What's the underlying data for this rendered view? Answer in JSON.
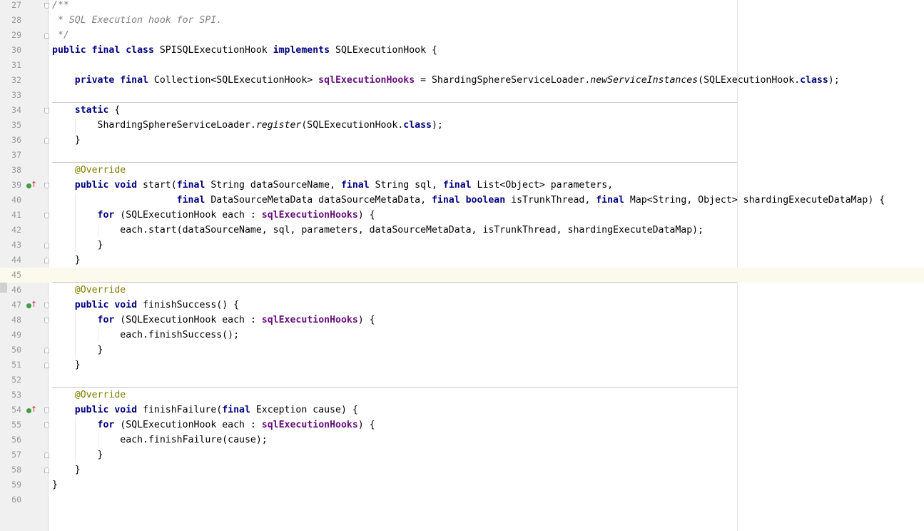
{
  "editor": {
    "lines": [
      {
        "n": "27",
        "tokens": [
          {
            "t": "/**",
            "c": "cm"
          }
        ]
      },
      {
        "n": "28",
        "tokens": [
          {
            "t": " * SQL Execution hook for SPI.",
            "c": "cm"
          }
        ]
      },
      {
        "n": "29",
        "tokens": [
          {
            "t": " */",
            "c": "cm"
          }
        ]
      },
      {
        "n": "30",
        "tokens": [
          {
            "t": "public final class",
            "c": "kw"
          },
          {
            "t": " SPISQLExecutionHook "
          },
          {
            "t": "implements",
            "c": "kw"
          },
          {
            "t": " SQLExecutionHook {"
          }
        ]
      },
      {
        "n": "31",
        "tokens": []
      },
      {
        "n": "32",
        "tokens": [
          {
            "t": "    "
          },
          {
            "t": "private final",
            "c": "kw"
          },
          {
            "t": " Collection<SQLExecutionHook> "
          },
          {
            "t": "sqlExecutionHooks",
            "c": "fd"
          },
          {
            "t": " = ShardingSphereServiceLoader."
          },
          {
            "t": "newServiceInstances",
            "c": "st"
          },
          {
            "t": "(SQLExecutionHook."
          },
          {
            "t": "class",
            "c": "kw"
          },
          {
            "t": ");"
          }
        ]
      },
      {
        "n": "33",
        "tokens": []
      },
      {
        "n": "34",
        "tokens": [
          {
            "t": "    "
          },
          {
            "t": "static",
            "c": "kw"
          },
          {
            "t": " {"
          }
        ]
      },
      {
        "n": "35",
        "tokens": [
          {
            "t": "        ShardingSphereServiceLoader."
          },
          {
            "t": "register",
            "c": "st"
          },
          {
            "t": "(SQLExecutionHook."
          },
          {
            "t": "class",
            "c": "kw"
          },
          {
            "t": ");"
          }
        ]
      },
      {
        "n": "36",
        "tokens": [
          {
            "t": "    }"
          }
        ]
      },
      {
        "n": "37",
        "tokens": []
      },
      {
        "n": "38",
        "tokens": [
          {
            "t": "    "
          },
          {
            "t": "@Override",
            "c": "an"
          }
        ]
      },
      {
        "n": "39",
        "tokens": [
          {
            "t": "    "
          },
          {
            "t": "public void",
            "c": "kw"
          },
          {
            "t": " start("
          },
          {
            "t": "final",
            "c": "kw"
          },
          {
            "t": " String dataSourceName, "
          },
          {
            "t": "final",
            "c": "kw"
          },
          {
            "t": " String sql, "
          },
          {
            "t": "final",
            "c": "kw"
          },
          {
            "t": " List<Object> parameters,"
          }
        ]
      },
      {
        "n": "40",
        "tokens": [
          {
            "t": "                      "
          },
          {
            "t": "final",
            "c": "kw"
          },
          {
            "t": " DataSourceMetaData dataSourceMetaData, "
          },
          {
            "t": "final boolean",
            "c": "kw"
          },
          {
            "t": " isTrunkThread, "
          },
          {
            "t": "final",
            "c": "kw"
          },
          {
            "t": " Map<String, Object> shardingExecuteDataMap) {"
          }
        ]
      },
      {
        "n": "41",
        "tokens": [
          {
            "t": "        "
          },
          {
            "t": "for",
            "c": "kw"
          },
          {
            "t": " (SQLExecutionHook each : "
          },
          {
            "t": "sqlExecutionHooks",
            "c": "fd"
          },
          {
            "t": ") {"
          }
        ]
      },
      {
        "n": "42",
        "tokens": [
          {
            "t": "            each.start(dataSourceName, sql, parameters, dataSourceMetaData, isTrunkThread, shardingExecuteDataMap);"
          }
        ]
      },
      {
        "n": "43",
        "tokens": [
          {
            "t": "        }"
          }
        ]
      },
      {
        "n": "44",
        "tokens": [
          {
            "t": "    }"
          }
        ]
      },
      {
        "n": "45",
        "tokens": []
      },
      {
        "n": "46",
        "tokens": [
          {
            "t": "    "
          },
          {
            "t": "@Override",
            "c": "an"
          }
        ]
      },
      {
        "n": "47",
        "tokens": [
          {
            "t": "    "
          },
          {
            "t": "public void",
            "c": "kw"
          },
          {
            "t": " finishSuccess() {"
          }
        ]
      },
      {
        "n": "48",
        "tokens": [
          {
            "t": "        "
          },
          {
            "t": "for",
            "c": "kw"
          },
          {
            "t": " (SQLExecutionHook each : "
          },
          {
            "t": "sqlExecutionHooks",
            "c": "fd"
          },
          {
            "t": ") {"
          }
        ]
      },
      {
        "n": "49",
        "tokens": [
          {
            "t": "            each.finishSuccess();"
          }
        ]
      },
      {
        "n": "50",
        "tokens": [
          {
            "t": "        }"
          }
        ]
      },
      {
        "n": "51",
        "tokens": [
          {
            "t": "    }"
          }
        ]
      },
      {
        "n": "52",
        "tokens": []
      },
      {
        "n": "53",
        "tokens": [
          {
            "t": "    "
          },
          {
            "t": "@Override",
            "c": "an"
          }
        ]
      },
      {
        "n": "54",
        "tokens": [
          {
            "t": "    "
          },
          {
            "t": "public void",
            "c": "kw"
          },
          {
            "t": " finishFailure("
          },
          {
            "t": "final",
            "c": "kw"
          },
          {
            "t": " Exception cause) {"
          }
        ]
      },
      {
        "n": "55",
        "tokens": [
          {
            "t": "        "
          },
          {
            "t": "for",
            "c": "kw"
          },
          {
            "t": " (SQLExecutionHook each : "
          },
          {
            "t": "sqlExecutionHooks",
            "c": "fd"
          },
          {
            "t": ") {"
          }
        ]
      },
      {
        "n": "56",
        "tokens": [
          {
            "t": "            each.finishFailure(cause);"
          }
        ]
      },
      {
        "n": "57",
        "tokens": [
          {
            "t": "        }"
          }
        ]
      },
      {
        "n": "58",
        "tokens": [
          {
            "t": "    }"
          }
        ]
      },
      {
        "n": "59",
        "tokens": [
          {
            "t": "}"
          }
        ]
      },
      {
        "n": "60",
        "tokens": []
      }
    ],
    "current_line": "45",
    "method_separators_after": [
      "33",
      "37",
      "45",
      "52"
    ],
    "override_markers": [
      "39",
      "47",
      "54"
    ],
    "override_marker_icon": "override-method-icon",
    "fold_start_lines": [
      "27",
      "34",
      "39",
      "41",
      "47",
      "48",
      "54",
      "55"
    ],
    "fold_end_lines": [
      "29",
      "36",
      "43",
      "44",
      "50",
      "51",
      "57",
      "58"
    ],
    "colors": {
      "keyword": "#000080",
      "comment": "#808080",
      "annotation": "#808000",
      "field": "#660e7a",
      "current_line_bg": "#fcfaed"
    }
  }
}
